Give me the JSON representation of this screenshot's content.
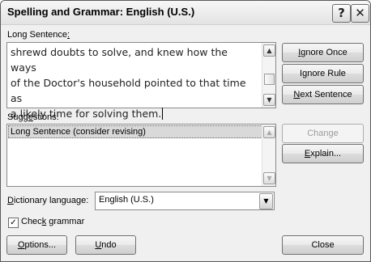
{
  "window": {
    "title": "Spelling and Grammar: English (U.S.)",
    "help_button": "?",
    "close_button": "✕"
  },
  "sentence": {
    "label_pre": "Long Sentence",
    "label_post": ":",
    "lines": [
      "shrewd doubts to solve, and knew how the ways",
      "of the Doctor's household pointed to that time as",
      "a likely time for solving them."
    ]
  },
  "buttons": {
    "ignore_once": {
      "pre": "",
      "u": "I",
      "post": "gnore Once"
    },
    "ignore_rule": {
      "pre": "I",
      "u": "g",
      "post": "nore Rule"
    },
    "next_sentence": {
      "pre": "",
      "u": "N",
      "post": "ext Sentence"
    },
    "change": "Change",
    "explain": {
      "pre": "",
      "u": "E",
      "post": "xplain..."
    },
    "options": {
      "pre": "",
      "u": "O",
      "post": "ptions..."
    },
    "undo": {
      "pre": "",
      "u": "U",
      "post": "ndo"
    },
    "close": "Close"
  },
  "suggestions": {
    "label_pre": "Sugg",
    "label_u": "e",
    "label_post": "stions:",
    "items": [
      "Long Sentence (consider revising)"
    ]
  },
  "dictionary": {
    "label_pre": "",
    "label_u": "D",
    "label_post": "ictionary language:",
    "value": "English (U.S.)"
  },
  "check_grammar": {
    "label_pre": "Chec",
    "label_u": "k",
    "label_post": " grammar",
    "checked": true,
    "mark": "✓"
  }
}
